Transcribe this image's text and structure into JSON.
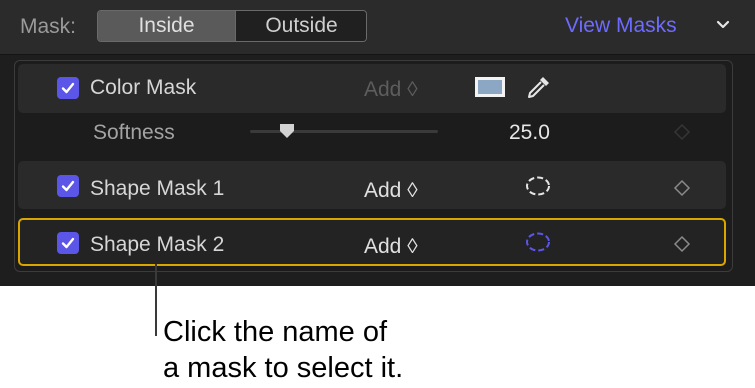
{
  "header": {
    "mask_label": "Mask:",
    "segments": [
      "Inside",
      "Outside"
    ],
    "selected_segment": "Inside",
    "view_masks_label": "View Masks"
  },
  "masks": [
    {
      "name": "Color Mask",
      "checked": true,
      "mode": "Add ◊",
      "mode_enabled": false
    },
    {
      "name": "Shape Mask 1",
      "checked": true,
      "mode": "Add ◊",
      "mode_enabled": true
    },
    {
      "name": "Shape Mask 2",
      "checked": true,
      "mode": "Add ◊",
      "mode_enabled": true,
      "selected": true
    }
  ],
  "softness": {
    "label": "Softness",
    "value": "25.0"
  },
  "colors": {
    "accent": "#6d6bff",
    "checkbox": "#5b56e8",
    "selection": "#d9a500",
    "swatch": "#8ca7c4"
  },
  "callout": {
    "line1": "Click the name of",
    "line2": "a mask to select it."
  }
}
